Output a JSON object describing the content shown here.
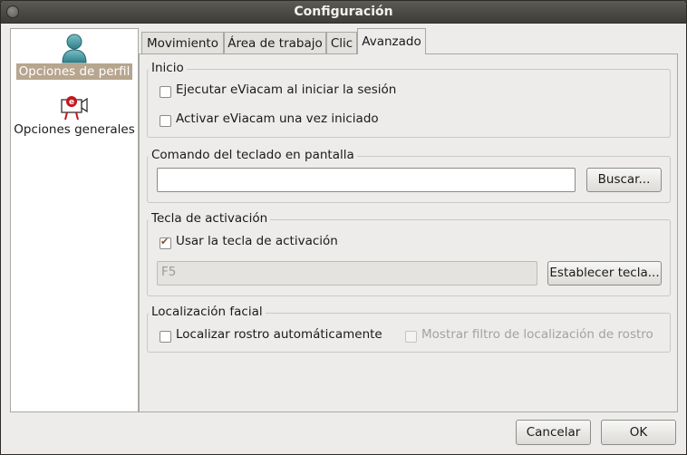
{
  "window": {
    "title": "Configuración"
  },
  "sidebar": {
    "items": [
      {
        "label": "Opciones de perfil",
        "icon": "user-icon",
        "selected": true
      },
      {
        "label": "Opciones generales",
        "icon": "eviacam-camera-icon",
        "selected": false
      }
    ]
  },
  "tabs": [
    {
      "label": "Movimiento",
      "active": false
    },
    {
      "label": "Área de trabajo",
      "active": false
    },
    {
      "label": "Clic",
      "active": false
    },
    {
      "label": "Avanzado",
      "active": true
    }
  ],
  "sections": {
    "inicio": {
      "legend": "Inicio",
      "options": [
        {
          "label": "Ejecutar eViacam al iniciar la sesión",
          "checked": false
        },
        {
          "label": "Activar eViacam una vez iniciado",
          "checked": false
        }
      ]
    },
    "teclado": {
      "legend": "Comando del teclado en pantalla",
      "value": "",
      "button": "Buscar..."
    },
    "activacion": {
      "legend": "Tecla de activación",
      "checkbox_label": "Usar la tecla de activación",
      "checked": true,
      "key_value": "F5",
      "button": "Establecer tecla..."
    },
    "localizacion": {
      "legend": "Localización facial",
      "auto_label": "Localizar rostro automáticamente",
      "auto_checked": false,
      "filter_label": "Mostrar filtro de localización de rostro",
      "filter_checked": false,
      "filter_enabled": false
    }
  },
  "footer": {
    "cancel": "Cancelar",
    "ok": "OK"
  }
}
